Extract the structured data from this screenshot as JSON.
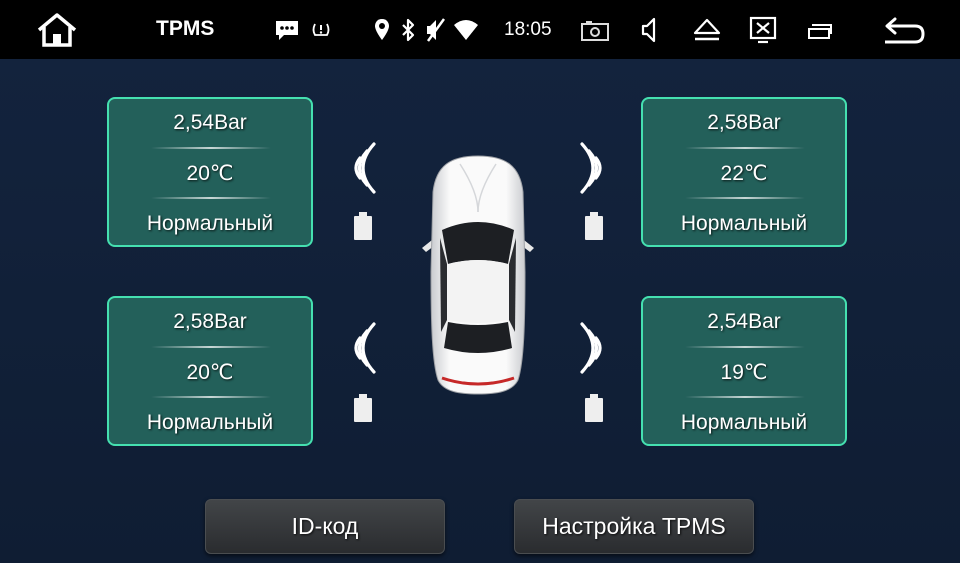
{
  "statusbar": {
    "title": "TPMS",
    "time": "18:05",
    "icons": [
      "home-icon",
      "message-icon",
      "tpms-icon",
      "location-icon",
      "bluetooth-icon",
      "mute-icon",
      "wifi-icon",
      "screenshot-icon",
      "volume-icon",
      "eject-icon",
      "screen-off-icon",
      "recent-apps-icon",
      "back-icon"
    ]
  },
  "tires": {
    "front_left": {
      "pressure": "2,54Bar",
      "temperature": "20℃",
      "status": "Нормальный"
    },
    "front_right": {
      "pressure": "2,58Bar",
      "temperature": "22℃",
      "status": "Нормальный"
    },
    "rear_left": {
      "pressure": "2,58Bar",
      "temperature": "20℃",
      "status": "Нормальный"
    },
    "rear_right": {
      "pressure": "2,54Bar",
      "temperature": "19℃",
      "status": "Нормальный"
    }
  },
  "buttons": {
    "id_code": "ID-код",
    "settings": "Настройка TPMS"
  },
  "colors": {
    "card_border": "#45e0b0",
    "card_fill": "#23605a",
    "background": "#11213a"
  }
}
